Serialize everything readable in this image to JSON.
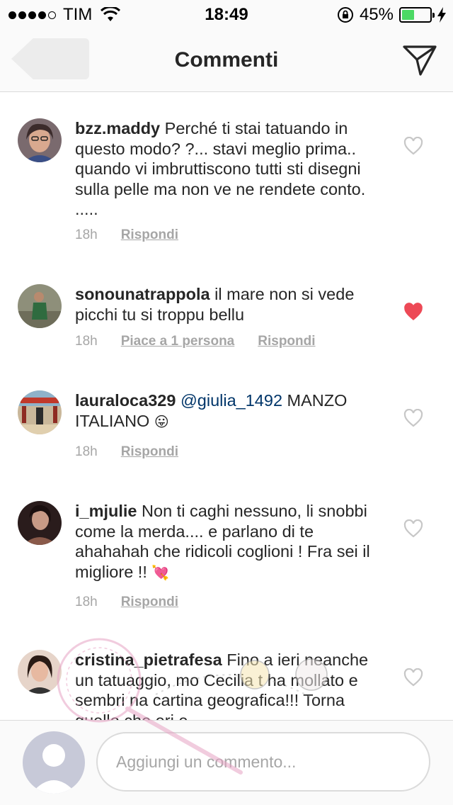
{
  "status_bar": {
    "carrier": "TIM",
    "time": "18:49",
    "battery": "45%",
    "battery_level": 0.45
  },
  "header": {
    "title": "Commenti",
    "back_icon": "back-arrow-icon",
    "send_icon": "direct-send-icon"
  },
  "comments": [
    {
      "username": "bzz.maddy",
      "text": "Perché ti stai tatuando in questo modo? ?... stavi meglio prima.. quando vi  imbruttiscono tutti sti disegni sulla pelle ma non ve ne rendete conto. .....",
      "time": "18h",
      "reply": "Rispondi",
      "liked": false
    },
    {
      "username": "sonounatrappola",
      "text": "il mare non si vede picchi tu si troppu bellu",
      "time": "18h",
      "likes": "Piace a 1 persona",
      "reply": "Rispondi",
      "liked": true
    },
    {
      "username": "lauraloca329",
      "mention": "@giulia_1492",
      "text": "MANZO ITALIANO",
      "emoji": "😛",
      "time": "18h",
      "reply": "Rispondi",
      "liked": false
    },
    {
      "username": "i_mjulie",
      "text": "Non ti caghi nessuno, li snobbi come la merda.... e parlano di te ahahahah che ridicoli coglioni ! Fra sei il migliore !!",
      "emoji": "💘",
      "time": "18h",
      "reply": "Rispondi",
      "liked": false
    },
    {
      "username": "cristina_pietrafesa",
      "text": "Fino a ieri neanche un tatuaggio, mo Cecilia t ha mollato e sembri na cartina geografica!!! Torna quello che eri e",
      "liked": false
    }
  ],
  "composer": {
    "placeholder": "Aggiungi un commento..."
  },
  "colors": {
    "heart_liked": "#ed4956",
    "heart_empty": "#c7c7c7",
    "mention": "#003569",
    "battery": "#4cd964"
  }
}
